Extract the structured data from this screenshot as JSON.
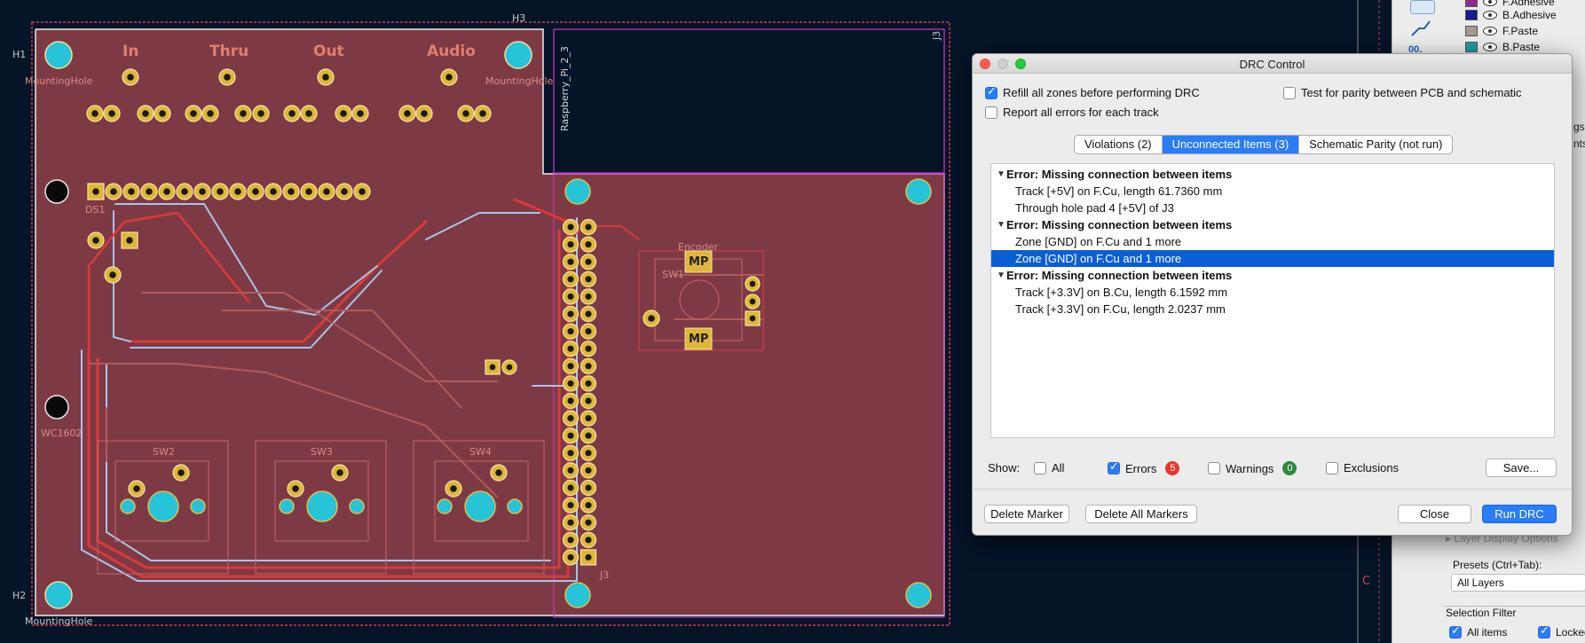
{
  "pcb": {
    "labels": {
      "h1": "H1",
      "h2": "H2",
      "h3": "H3",
      "j3_top": "J3",
      "j3_bottom": "J3",
      "mounting_hole_1": "MountingHole",
      "mounting_hole_2": "MountingHole",
      "mounting_hole_3": "MountingHole",
      "raspberry_pi": "Raspberry_Pi_2_3",
      "in": "In",
      "thru": "Thru",
      "out": "Out",
      "audio": "Audio",
      "ds1": "DS1",
      "wc1602": "WC1602",
      "sw2": "SW2",
      "sw3": "SW3",
      "sw4": "SW4",
      "sw1": "SW1",
      "encoder": "Encoder",
      "mp1": "MP",
      "mp2": "MP",
      "edge_c": "C"
    }
  },
  "layers": {
    "items": [
      {
        "name": "F.Adhesive",
        "color": "#8e2a8c"
      },
      {
        "name": "B.Adhesive",
        "color": "#1a1a8c"
      },
      {
        "name": "F.Paste",
        "color": "#a59a8d"
      },
      {
        "name": "B.Paste",
        "color": "#1f9aa1"
      }
    ],
    "side_text": [
      "gs",
      "nts"
    ],
    "layer_display_options": "Layer Display Options",
    "presets_label": "Presets (Ctrl+Tab):",
    "presets_value": "All Layers",
    "selection_filter": "Selection Filter",
    "all_items": "All items",
    "locked": "Locked"
  },
  "drc": {
    "title": "DRC Control",
    "refill_zones": "Refill all zones before performing DRC",
    "report_all_errors": "Report all errors for each track",
    "test_parity": "Test for parity between PCB and schematic",
    "tabs": [
      "Violations (2)",
      "Unconnected Items (3)",
      "Schematic Parity (not run)"
    ],
    "active_tab": 1,
    "entries": [
      {
        "error": "Error: Missing connection between items",
        "items": [
          "Track [+5V] on F.Cu, length 61.7360 mm",
          "Through hole pad 4 [+5V] of J3"
        ]
      },
      {
        "error": "Error: Missing connection between items",
        "items": [
          "Zone [GND] on F.Cu and 1 more",
          "Zone [GND] on F.Cu and 1 more"
        ]
      },
      {
        "error": "Error: Missing connection between items",
        "items": [
          "Track [+3.3V] on B.Cu, length 6.1592 mm",
          "Track [+3.3V] on F.Cu, length 2.0237 mm"
        ]
      }
    ],
    "show": {
      "label": "Show:",
      "all": "All",
      "errors": "Errors",
      "errors_count": "5",
      "errors_color": "#e5372a",
      "warnings": "Warnings",
      "warnings_count": "0",
      "warnings_color": "#2b8a3e",
      "exclusions": "Exclusions"
    },
    "buttons": {
      "save": "Save...",
      "delete_marker": "Delete Marker",
      "delete_all_markers": "Delete All Markers",
      "close": "Close",
      "run_drc": "Run DRC"
    }
  }
}
